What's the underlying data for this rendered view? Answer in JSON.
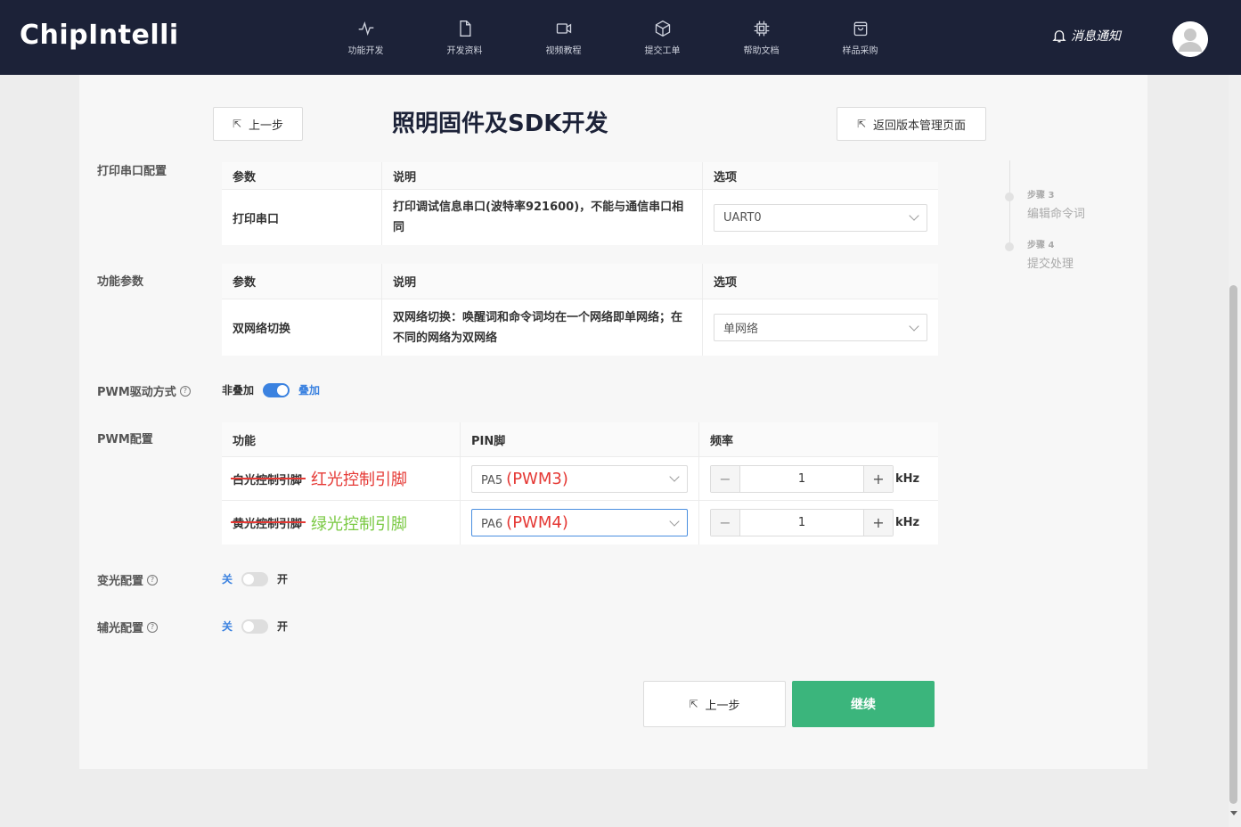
{
  "brand": {
    "logo": "ChipIntelli"
  },
  "nav": [
    {
      "label": "功能开发",
      "icon": "activity-icon"
    },
    {
      "label": "开发资料",
      "icon": "document-icon"
    },
    {
      "label": "视频教程",
      "icon": "video-icon"
    },
    {
      "label": "提交工单",
      "icon": "box-icon"
    },
    {
      "label": "帮助文档",
      "icon": "chip-icon"
    },
    {
      "label": "样品采购",
      "icon": "shopping-bag-icon"
    }
  ],
  "header": {
    "notice": "消息通知"
  },
  "page": {
    "title": "照明固件及SDK开发",
    "prev_label": "上一步",
    "back_label": "返回版本管理页面"
  },
  "sections": {
    "serial": {
      "label": "打印串口配置",
      "headers": [
        "参数",
        "说明",
        "选项"
      ],
      "row": {
        "param": "打印串口",
        "desc": "打印调试信息串口(波特率921600)，不能与通信串口相同",
        "option": "UART0"
      }
    },
    "func": {
      "label": "功能参数",
      "headers": [
        "参数",
        "说明",
        "选项"
      ],
      "row": {
        "param": "双网络切换",
        "desc": "双网络切换：唤醒词和命令词均在一个网络即单网络；在不同的网络为双网络",
        "option": "单网络"
      }
    },
    "pwm_mode": {
      "label": "PWM驱动方式",
      "off": "非叠加",
      "on": "叠加",
      "state": true
    },
    "pwm": {
      "label": "PWM配置",
      "headers": [
        "功能",
        "PIN脚",
        "频率"
      ],
      "rows": [
        {
          "func": "白光控制引脚",
          "annot": "红光控制引脚",
          "pin": "PA5",
          "pin_annot": "(PWM3)",
          "freq": "1",
          "unit": "kHz"
        },
        {
          "func": "黄光控制引脚",
          "annot": "绿光控制引脚",
          "pin": "PA6",
          "pin_annot": "(PWM4)",
          "freq": "1",
          "unit": "kHz"
        }
      ]
    },
    "dimming": {
      "label": "变光配置",
      "off": "关",
      "on": "开",
      "state": false
    },
    "aux": {
      "label": "辅光配置",
      "off": "关",
      "on": "开",
      "state": false
    }
  },
  "steps": [
    {
      "small": "步骤 3",
      "big": "编辑命令词"
    },
    {
      "small": "步骤 4",
      "big": "提交处理"
    }
  ],
  "footer": {
    "prev_label": "上一步",
    "continue_label": "继续"
  },
  "colors": {
    "nav_bg": "#1c2238",
    "accent": "#3b82e0",
    "continue": "#3bb57c",
    "annot_red": "#e53935",
    "annot_green": "#7ac943"
  }
}
